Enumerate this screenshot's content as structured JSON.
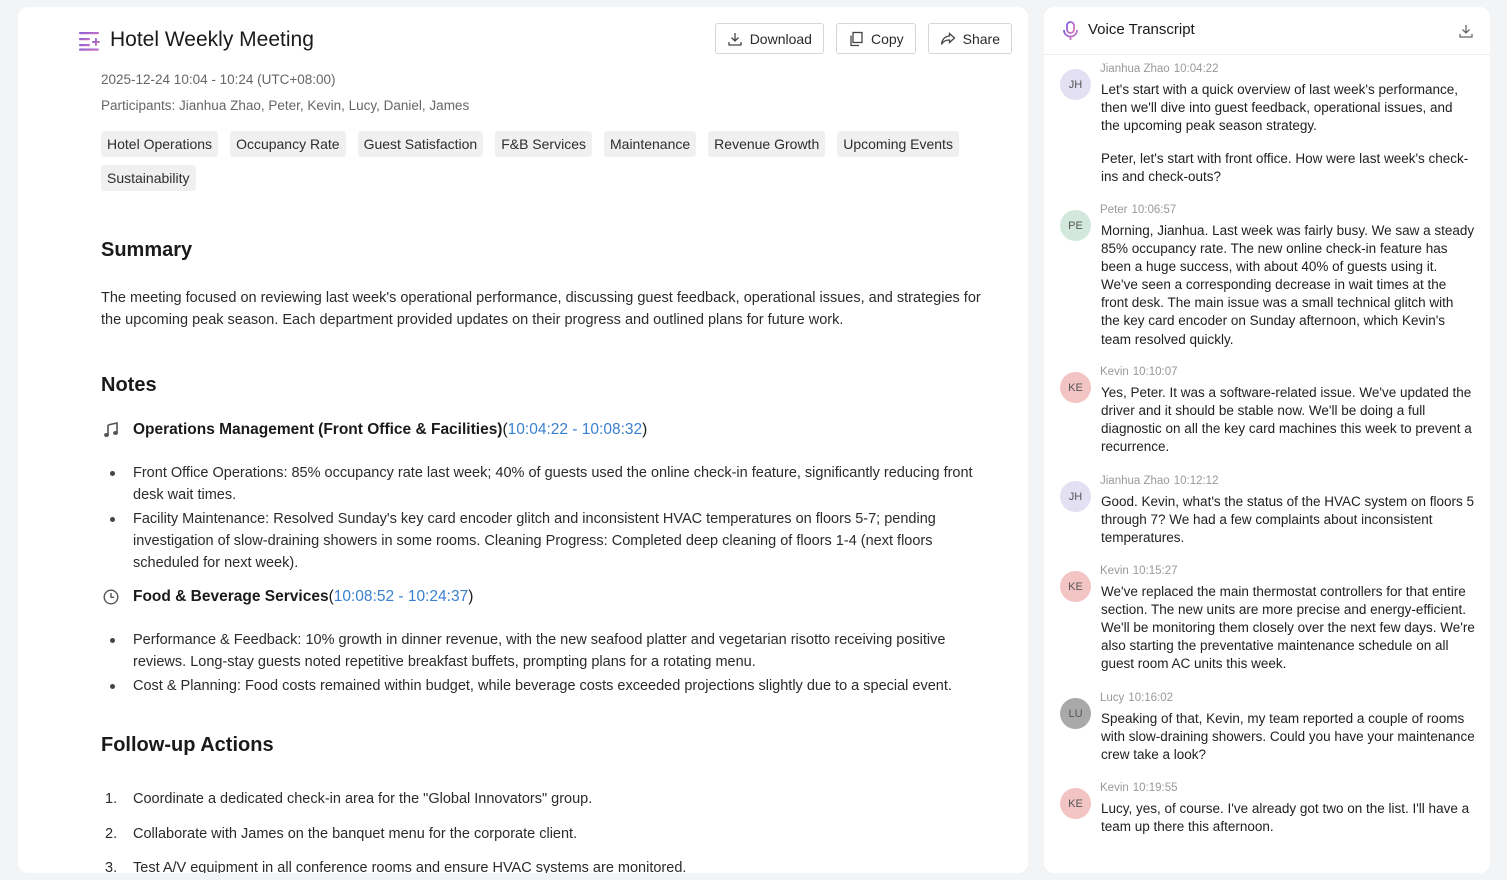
{
  "header": {
    "title": "Hotel Weekly Meeting",
    "download_label": "Download",
    "copy_label": "Copy",
    "share_label": "Share",
    "date": "2025-12-24 10:04 - 10:24 (UTC+08:00)",
    "participants": "Participants: Jianhua Zhao, Peter, Kevin, Lucy, Daniel, James"
  },
  "tags": [
    "Hotel Operations",
    "Occupancy Rate",
    "Guest Satisfaction",
    "F&B Services",
    "Maintenance",
    "Revenue Growth",
    "Upcoming Events",
    "Sustainability"
  ],
  "summary": {
    "heading": "Summary",
    "text": "The meeting focused on reviewing last week's operational performance, discussing guest feedback, operational issues, and strategies for the upcoming peak season. Each department provided updates on their progress and outlined plans for future work."
  },
  "notes": {
    "heading": "Notes",
    "sections": [
      {
        "icon": "music-note-icon",
        "title": "Operations Management (Front Office & Facilities)",
        "start": "10:04:22",
        "end": "10:08:32",
        "bullets": [
          "Front Office Operations: 85% occupancy rate last week; 40% of guests used the online check-in feature, significantly reducing front desk wait times.",
          "Facility Maintenance: Resolved Sunday's key card encoder glitch and inconsistent HVAC temperatures on floors 5-7; pending investigation of slow-draining showers in some rooms. Cleaning Progress: Completed deep cleaning of floors 1-4 (next floors scheduled for next week)."
        ]
      },
      {
        "icon": "clock-icon",
        "title": "Food & Beverage Services",
        "start": "10:08:52",
        "end": "10:24:37",
        "bullets": [
          "Performance & Feedback: 10% growth in dinner revenue, with the new seafood platter and vegetarian risotto receiving positive reviews. Long-stay guests noted repetitive breakfast buffets, prompting plans for a rotating menu.",
          "Cost & Planning: Food costs remained within budget, while beverage costs exceeded projections slightly due to a special event."
        ]
      }
    ]
  },
  "followup": {
    "heading": "Follow-up Actions",
    "items": [
      {
        "num": "1.",
        "text": "Coordinate a dedicated check-in area for the \"Global Innovators\" group."
      },
      {
        "num": "2.",
        "text": "Collaborate with James on the banquet menu for the corporate client."
      },
      {
        "num": "3.",
        "text": "Test A/V equipment in all conference rooms and ensure HVAC systems are monitored."
      }
    ]
  },
  "transcript": {
    "title": "Voice Transcript",
    "entries": [
      {
        "initials": "JH",
        "name": "Jianhua Zhao",
        "time": "10:04:22",
        "avatar_color": "#e4e0f3",
        "paragraphs": [
          "Let's start with a quick overview of last week's performance, then we'll dive into guest feedback, operational issues, and the upcoming peak season strategy.",
          "Peter, let's start with front office. How were last week's check-ins and check-outs?"
        ]
      },
      {
        "initials": "PE",
        "name": "Peter",
        "time": "10:06:57",
        "avatar_color": "#d3e8dc",
        "paragraphs": [
          "Morning, Jianhua. Last week was fairly busy. We saw a steady 85% occupancy rate. The new online check-in feature has been a huge success, with about 40% of guests using it. We've seen a corresponding decrease in wait times at the front desk. The main issue was a small technical glitch with the key card encoder on Sunday afternoon, which Kevin's team resolved quickly."
        ]
      },
      {
        "initials": "KE",
        "name": "Kevin",
        "time": "10:10:07",
        "avatar_color": "#f3c4c4",
        "paragraphs": [
          "Yes, Peter. It was a software-related issue. We've updated the driver and it should be stable now. We'll be doing a full diagnostic on all the key card machines this week to prevent a recurrence."
        ]
      },
      {
        "initials": "JH",
        "name": "Jianhua Zhao",
        "time": "10:12:12",
        "avatar_color": "#e4e0f3",
        "paragraphs": [
          "Good. Kevin, what's the status of the HVAC system on floors 5 through 7? We had a few complaints about inconsistent temperatures."
        ]
      },
      {
        "initials": "KE",
        "name": "Kevin",
        "time": "10:15:27",
        "avatar_color": "#f3c4c4",
        "paragraphs": [
          "We've replaced the main thermostat controllers for that entire section. The new units are more precise and energy-efficient. We'll be monitoring them closely over the next few days. We're also starting the preventative maintenance schedule on all guest room AC units this week."
        ]
      },
      {
        "initials": "LU",
        "name": "Lucy",
        "time": "10:16:02",
        "avatar_color": "#a9a9a9",
        "paragraphs": [
          "Speaking of that, Kevin, my team reported a couple of rooms with slow-draining showers. Could you have your maintenance crew take a look?"
        ]
      },
      {
        "initials": "KE",
        "name": "Kevin",
        "time": "10:19:55",
        "avatar_color": "#f3c4c4",
        "paragraphs": [
          "Lucy, yes, of course. I've already got two on the list. I'll have a team up there this afternoon."
        ]
      }
    ]
  },
  "colors": {
    "accent": "#3a7fd0",
    "title_icon": "#8a6ad8"
  }
}
